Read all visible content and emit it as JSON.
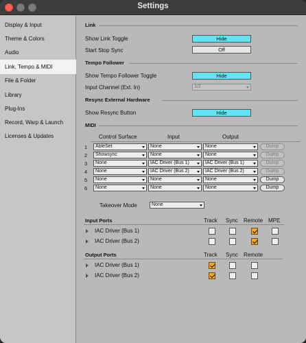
{
  "window": {
    "title": "Settings"
  },
  "sidebar": {
    "items": [
      {
        "label": "Display & Input",
        "active": false
      },
      {
        "label": "Theme & Colors",
        "active": false
      },
      {
        "label": "Audio",
        "active": false
      },
      {
        "label": "Link, Tempo & MIDI",
        "active": true
      },
      {
        "label": "File & Folder",
        "active": false
      },
      {
        "label": "Library",
        "active": false
      },
      {
        "label": "Plug-Ins",
        "active": false
      },
      {
        "label": "Record, Warp & Launch",
        "active": false
      },
      {
        "label": "Licenses & Updates",
        "active": false
      }
    ]
  },
  "link": {
    "section_title": "Link",
    "show_link_toggle_label": "Show Link Toggle",
    "show_link_toggle_value": "Hide",
    "start_stop_sync_label": "Start Stop Sync",
    "start_stop_sync_value": "Off"
  },
  "tempo_follower": {
    "section_title": "Tempo Follower",
    "show_toggle_label": "Show Tempo Follower Toggle",
    "show_toggle_value": "Hide",
    "input_channel_label": "Input Channel (Ext. In)",
    "input_channel_value": "1/2"
  },
  "resync": {
    "section_title": "Resync External Hardware",
    "show_button_label": "Show Resync Button",
    "show_button_value": "Hide"
  },
  "midi": {
    "section_title": "MIDI",
    "headers": {
      "control_surface": "Control Surface",
      "input": "Input",
      "output": "Output"
    },
    "dump_label": "Dump",
    "rows": [
      {
        "num": "1",
        "surface": "AbleSet",
        "input": "None",
        "output": "None",
        "dump_enabled": false
      },
      {
        "num": "2",
        "surface": "Showsync",
        "input": "None",
        "output": "None",
        "dump_enabled": false
      },
      {
        "num": "3",
        "surface": "None",
        "input": "IAC Driver (Bus 1)",
        "output": "IAC Driver (Bus 1)",
        "dump_enabled": false
      },
      {
        "num": "4",
        "surface": "None",
        "input": "IAC Driver (Bus 2)",
        "output": "IAC Driver (Bus 2)",
        "dump_enabled": false
      },
      {
        "num": "5",
        "surface": "None",
        "input": "None",
        "output": "None",
        "dump_enabled": true
      },
      {
        "num": "6",
        "surface": "None",
        "input": "None",
        "output": "None",
        "dump_enabled": true
      }
    ],
    "takeover_mode_label": "Takeover Mode",
    "takeover_mode_value": "None"
  },
  "input_ports": {
    "title": "Input Ports",
    "columns": [
      "Track",
      "Sync",
      "Remote",
      "MPE"
    ],
    "rows": [
      {
        "name": "IAC Driver (Bus 1)",
        "track": false,
        "sync": false,
        "remote": true,
        "mpe": false
      },
      {
        "name": "IAC Driver (Bus 2)",
        "track": false,
        "sync": false,
        "remote": true,
        "mpe": false
      }
    ]
  },
  "output_ports": {
    "title": "Output Ports",
    "columns": [
      "Track",
      "Sync",
      "Remote"
    ],
    "rows": [
      {
        "name": "IAC Driver (Bus 1)",
        "track": true,
        "sync": false,
        "remote": false
      },
      {
        "name": "IAC Driver (Bus 2)",
        "track": true,
        "sync": false,
        "remote": false
      }
    ]
  },
  "colors": {
    "toggle_cyan": "#62e4f5",
    "checkbox_orange": "#f5a623",
    "close_red": "#ff5f57"
  },
  "icons": {
    "expand": "triangle-right-icon",
    "dropdown": "chevron-down-icon",
    "checkbox_checked": "checkmark-icon"
  }
}
